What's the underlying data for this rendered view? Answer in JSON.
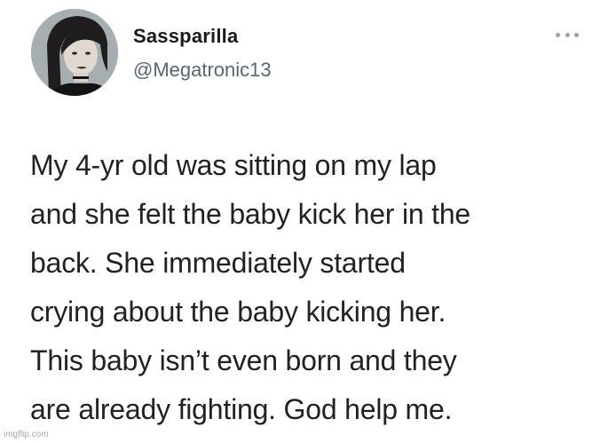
{
  "tweet": {
    "display_name": "Sassparilla",
    "handle": "@Megatronic13",
    "more_icon": "ellipsis-icon",
    "avatar_icon": "profile-photo",
    "text_lines": [
      "My 4-yr old was sitting on my lap",
      "and she felt the baby kick her in the",
      "back. She immediately started",
      "crying about the baby kicking her.",
      "This baby isn’t even born and they",
      "are already fighting. God help me."
    ]
  },
  "watermark": "imgflip.com"
}
